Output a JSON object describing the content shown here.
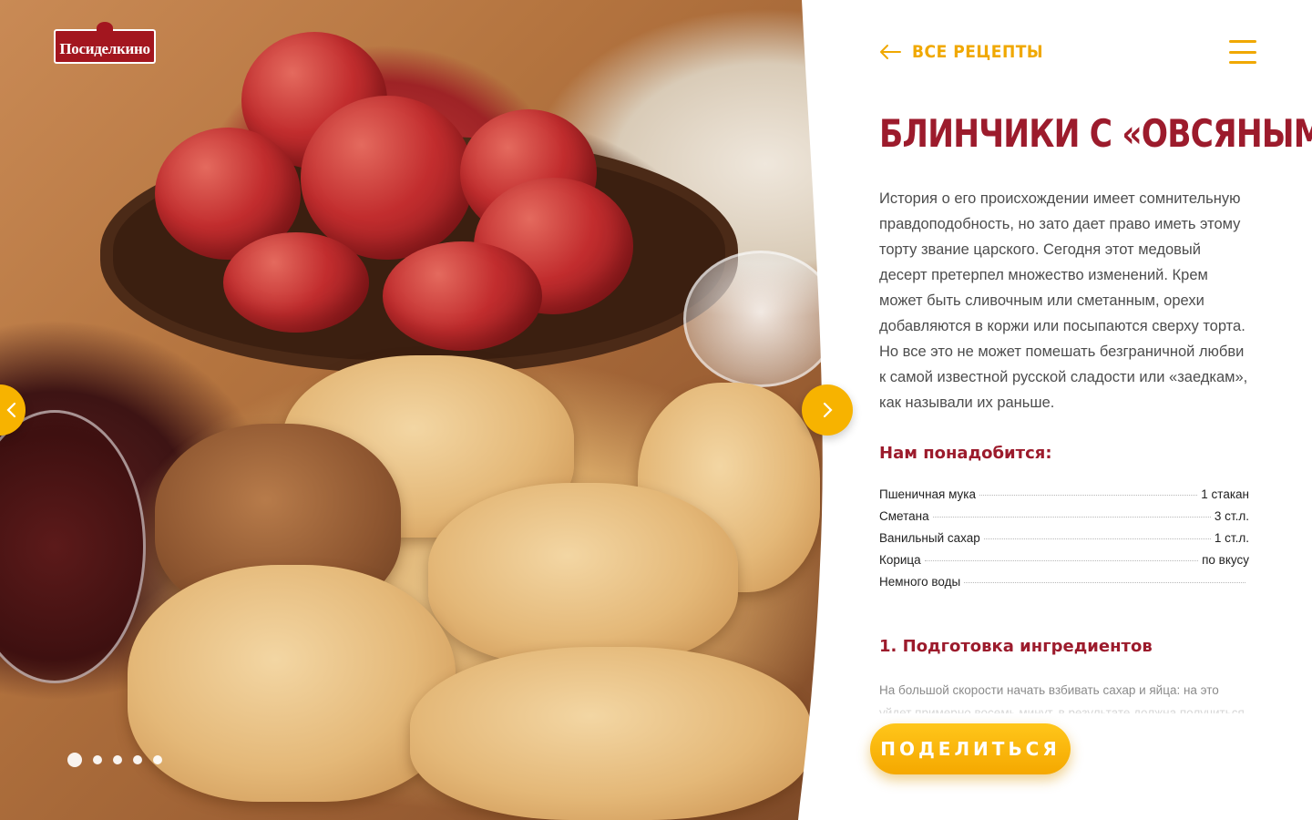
{
  "brand": {
    "logo_text": "Посиделкино",
    "accent": "#f0a800",
    "title_color": "#9c1b2c"
  },
  "photo": {
    "alt": "Блинчики в форме сердца, тарелка с яблоками"
  },
  "slider": {
    "total": 5,
    "active": 1
  },
  "header": {
    "back_label": "Все рецепты"
  },
  "recipe": {
    "title": "Блинчики с «овсяным»",
    "description": "История о его происхождении имеет сомнительную правдоподобность, но зато дает право иметь этому торту звание царского. Сегодня этот медовый десерт претерпел множество изменений. Крем может быть сливочным или сметанным, орехи добавляются в коржи или посыпаются сверху торта. Но все это не может помешать безграничной любви к самой известной русской сладости или «заедкам», как называли их раньше.",
    "ingredients_title": "Нам понадобится:",
    "ingredients": [
      {
        "name": "Пшеничная мука",
        "amount": "1 стакан"
      },
      {
        "name": "Сметана",
        "amount": "3 ст.л."
      },
      {
        "name": "Ванильный сахар",
        "amount": "1 ст.л."
      },
      {
        "name": "Корица",
        "amount": "по вкусу"
      },
      {
        "name": "Немного воды",
        "amount": ""
      }
    ],
    "steps": [
      {
        "title": "1. Подготовка ингредиентов",
        "text": "На большой скорости начать взбивать сахар и яйца: на это уйдет примерно восемь минут, в результате должна получиться"
      }
    ]
  },
  "share": {
    "label": "Поделиться"
  }
}
